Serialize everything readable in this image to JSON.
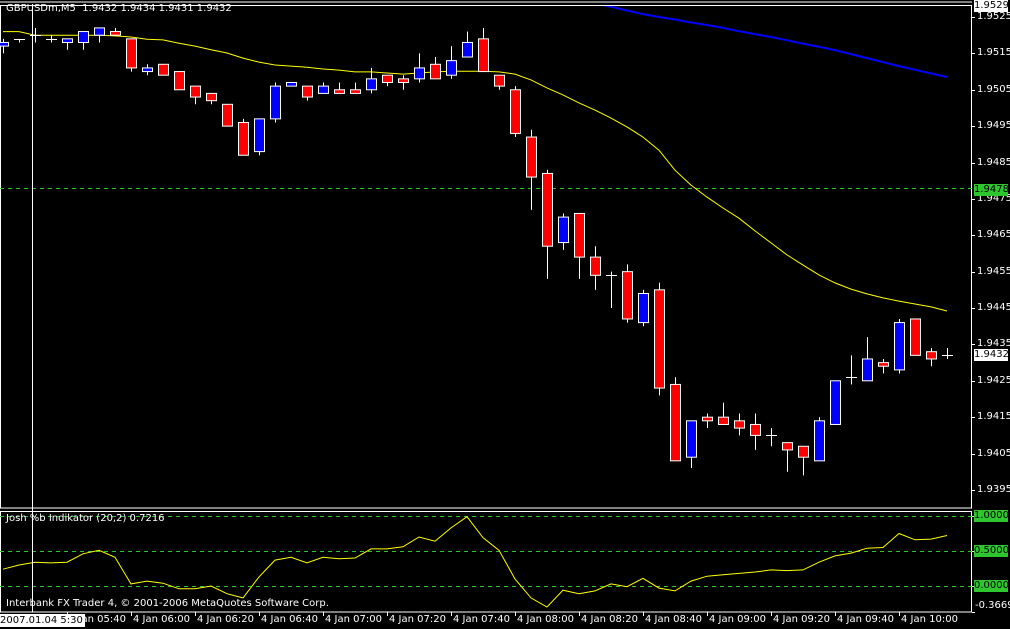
{
  "header": {
    "symbol_timeframe": "GBPUSDm,M5",
    "ohlc_text": "1.9432 1.9434 1.9431 1.9432"
  },
  "indicator": {
    "title": "Josh %b Indikator (20,2) 0.7216"
  },
  "copyright": "Interbank FX Trader 4, © 2001-2006 MetaQuotes Software Corp.",
  "colors": {
    "bull": "#0000ff",
    "bear": "#ff0000",
    "ma_fast": "#ffff00",
    "ma_slow": "#0000ff",
    "grid_level": "#2fc52f",
    "label_green": "#2fc52f"
  },
  "price_axis": {
    "labels": [
      "1.9525",
      "1.9515",
      "1.9505",
      "1.9495",
      "1.9485",
      "1.9475",
      "1.9465",
      "1.9455",
      "1.9445",
      "1.9435",
      "1.9425",
      "1.9415",
      "1.9405",
      "1.9395"
    ],
    "top_box": "1.9529",
    "current_price_box": "1.9432",
    "hline_box": "1.9478"
  },
  "indicator_axis": {
    "labels": [
      "1.0000",
      "0.5000",
      "0.0000"
    ],
    "min_label": "-0.3669"
  },
  "time_axis": {
    "cursor_label": "2007.01.04 5:30",
    "labels": [
      "4 Jan 05:40",
      "4 Jan 06:00",
      "4 Jan 06:20",
      "4 Jan 06:40",
      "4 Jan 07:00",
      "4 Jan 07:20",
      "4 Jan 07:40",
      "4 Jan 08:00",
      "4 Jan 08:20",
      "4 Jan 08:40",
      "4 Jan 09:00",
      "4 Jan 09:20",
      "4 Jan 09:40",
      "4 Jan 10:00"
    ]
  },
  "chart_data": {
    "type": "candlestick",
    "symbol": "GBPUSDm",
    "timeframe": "M5",
    "ylim": [
      1.939,
      1.9529
    ],
    "horizontal_line": 1.9478,
    "ohlc": [
      [
        1.9517,
        1.9519,
        1.9515,
        1.9518
      ],
      [
        1.9519,
        1.9519,
        1.9518,
        1.9519
      ],
      [
        1.952,
        1.9522,
        1.9518,
        1.952
      ],
      [
        1.9519,
        1.952,
        1.9518,
        1.9519
      ],
      [
        1.9518,
        1.9519,
        1.9516,
        1.9519
      ],
      [
        1.9518,
        1.9521,
        1.9516,
        1.9521
      ],
      [
        1.952,
        1.9522,
        1.9518,
        1.9522
      ],
      [
        1.9521,
        1.9522,
        1.952,
        1.952
      ],
      [
        1.9519,
        1.9519,
        1.951,
        1.9511
      ],
      [
        1.951,
        1.9512,
        1.9509,
        1.9511
      ],
      [
        1.9512,
        1.9512,
        1.9509,
        1.9509
      ],
      [
        1.951,
        1.951,
        1.9505,
        1.9505
      ],
      [
        1.9506,
        1.9506,
        1.9501,
        1.9503
      ],
      [
        1.9504,
        1.9504,
        1.9501,
        1.9502
      ],
      [
        1.9501,
        1.9501,
        1.9495,
        1.9495
      ],
      [
        1.9496,
        1.9497,
        1.9487,
        1.9487
      ],
      [
        1.9488,
        1.9497,
        1.9487,
        1.9497
      ],
      [
        1.9497,
        1.9507,
        1.9496,
        1.9506
      ],
      [
        1.9506,
        1.9507,
        1.9506,
        1.9507
      ],
      [
        1.9506,
        1.9506,
        1.9502,
        1.9503
      ],
      [
        1.9504,
        1.9507,
        1.9504,
        1.9506
      ],
      [
        1.9505,
        1.9507,
        1.9504,
        1.9504
      ],
      [
        1.9505,
        1.9507,
        1.9504,
        1.9504
      ],
      [
        1.9505,
        1.9511,
        1.9504,
        1.9508
      ],
      [
        1.9509,
        1.9509,
        1.9506,
        1.9507
      ],
      [
        1.9508,
        1.9509,
        1.9505,
        1.9507
      ],
      [
        1.9508,
        1.9515,
        1.9507,
        1.9511
      ],
      [
        1.9512,
        1.9514,
        1.9508,
        1.9508
      ],
      [
        1.9509,
        1.9517,
        1.9508,
        1.9513
      ],
      [
        1.9514,
        1.9521,
        1.9514,
        1.9518
      ],
      [
        1.9519,
        1.9522,
        1.951,
        1.951
      ],
      [
        1.9509,
        1.9509,
        1.9505,
        1.9506
      ],
      [
        1.9505,
        1.9506,
        1.9492,
        1.9493
      ],
      [
        1.9492,
        1.9494,
        1.9472,
        1.9481
      ],
      [
        1.9482,
        1.9483,
        1.9453,
        1.9462
      ],
      [
        1.9463,
        1.9471,
        1.9461,
        1.947
      ],
      [
        1.9471,
        1.9471,
        1.9453,
        1.9459
      ],
      [
        1.9459,
        1.9462,
        1.945,
        1.9454
      ],
      [
        1.9454,
        1.9455,
        1.9445,
        1.9454
      ],
      [
        1.9455,
        1.9457,
        1.9441,
        1.9442
      ],
      [
        1.9441,
        1.945,
        1.944,
        1.9449
      ],
      [
        1.945,
        1.9452,
        1.9421,
        1.9423
      ],
      [
        1.9424,
        1.9426,
        1.9403,
        1.9403
      ],
      [
        1.9404,
        1.9414,
        1.9401,
        1.9414
      ],
      [
        1.9415,
        1.9416,
        1.9412,
        1.9414
      ],
      [
        1.9415,
        1.9419,
        1.9413,
        1.9413
      ],
      [
        1.9414,
        1.9416,
        1.941,
        1.9412
      ],
      [
        1.9413,
        1.9416,
        1.9406,
        1.941
      ],
      [
        1.941,
        1.9412,
        1.9407,
        1.941
      ],
      [
        1.9408,
        1.9408,
        1.94,
        1.9406
      ],
      [
        1.9407,
        1.9407,
        1.9399,
        1.9404
      ],
      [
        1.9403,
        1.9415,
        1.9403,
        1.9414
      ],
      [
        1.9413,
        1.9425,
        1.9413,
        1.9425
      ],
      [
        1.9426,
        1.9432,
        1.9424,
        1.9426
      ],
      [
        1.9425,
        1.9437,
        1.9425,
        1.9431
      ],
      [
        1.943,
        1.9431,
        1.9427,
        1.9429
      ],
      [
        1.9428,
        1.9442,
        1.9427,
        1.9441
      ],
      [
        1.9442,
        1.9442,
        1.9432,
        1.9432
      ],
      [
        1.9433,
        1.9434,
        1.9429,
        1.9431
      ],
      [
        1.9432,
        1.9434,
        1.9431,
        1.9432
      ]
    ],
    "ma_fast": [
      1.9521,
      1.9521,
      1.952,
      1.952,
      1.952,
      1.952,
      1.952,
      1.95198,
      1.95195,
      1.95189,
      1.95187,
      1.95178,
      1.9517,
      1.9516,
      1.95151,
      1.95137,
      1.95126,
      1.95118,
      1.95115,
      1.95112,
      1.95107,
      1.95104,
      1.95099,
      1.95099,
      1.95096,
      1.95093,
      1.95096,
      1.95099,
      1.95101,
      1.95101,
      1.95101,
      1.95099,
      1.95093,
      1.95077,
      1.95055,
      1.95036,
      1.95014,
      1.94994,
      1.94972,
      1.94948,
      1.9492,
      1.94884,
      1.94829,
      1.94788,
      1.94755,
      1.94725,
      1.94697,
      1.94662,
      1.94629,
      1.94596,
      1.94568,
      1.94541,
      1.94519,
      1.94502,
      1.94489,
      1.94478,
      1.94469,
      1.94461,
      1.94453,
      1.94442
    ],
    "ma_slow": [
      null,
      null,
      null,
      null,
      null,
      null,
      null,
      null,
      null,
      null,
      null,
      null,
      null,
      null,
      null,
      null,
      null,
      null,
      null,
      null,
      null,
      null,
      null,
      null,
      null,
      null,
      null,
      null,
      null,
      null,
      null,
      null,
      null,
      null,
      null,
      null,
      null,
      1.95288,
      1.95278,
      1.95268,
      1.95258,
      1.9525,
      1.95243,
      1.95235,
      1.95228,
      1.9522,
      1.95211,
      1.95203,
      1.95195,
      1.95186,
      1.95177,
      1.95168,
      1.95159,
      1.95148,
      1.95137,
      1.95126,
      1.95115,
      1.95105,
      1.95095,
      1.95085
    ],
    "percent_b": {
      "levels": [
        1.0,
        0.5,
        0.0
      ],
      "ylim": [
        -0.3669,
        1.0
      ],
      "values": [
        0.24,
        0.3,
        0.34,
        0.33,
        0.34,
        0.46,
        0.51,
        0.41,
        0.03,
        0.07,
        0.04,
        -0.04,
        -0.04,
        0.0,
        -0.11,
        -0.17,
        0.13,
        0.37,
        0.41,
        0.33,
        0.41,
        0.39,
        0.4,
        0.53,
        0.53,
        0.56,
        0.7,
        0.64,
        0.83,
        0.99,
        0.69,
        0.51,
        0.1,
        -0.17,
        -0.3,
        -0.06,
        -0.11,
        -0.07,
        0.03,
        -0.01,
        0.11,
        -0.03,
        -0.07,
        0.07,
        0.14,
        0.16,
        0.18,
        0.2,
        0.23,
        0.22,
        0.23,
        0.34,
        0.43,
        0.47,
        0.54,
        0.55,
        0.75,
        0.66,
        0.67,
        0.7216
      ]
    }
  }
}
